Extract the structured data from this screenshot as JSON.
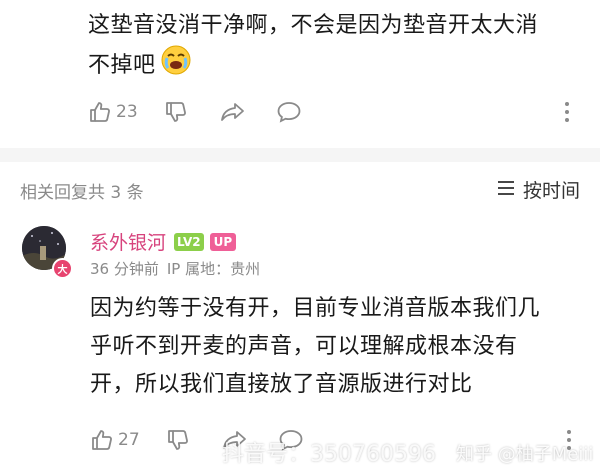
{
  "top_comment": {
    "text_line1": "这垫音没消干净啊，不会是因为垫音开太大消",
    "text_line2": "不掉吧",
    "emoji": "face-with-tears-emoji",
    "like_count": "23"
  },
  "replies_header": {
    "count_label": "相关回复共 3 条",
    "sort_label": "按时间",
    "sort_icon": "list-icon"
  },
  "reply": {
    "username": "系外银河",
    "level_badge": "LV2",
    "up_badge": "UP",
    "avatar_badge": "大",
    "time": "36 分钟前",
    "ip_label": "IP 属地：",
    "ip_location": "贵州",
    "text_line1": "因为约等于没有开，目前专业消音版本我们几",
    "text_line2": "乎听不到开麦的声音，可以理解成根本没有",
    "text_line3": "开，所以我们直接放了音源版进行对比",
    "like_count": "27"
  },
  "watermarks": {
    "douyin": "抖音号：350760596",
    "zhihu": "知乎 @柚子Meiii"
  },
  "colors": {
    "username": "#d7437d",
    "level_badge": "#8ccf4a",
    "up_badge": "#ef5f97",
    "divider": "#f5f5f5",
    "meta_gray": "#8a8a8a"
  }
}
